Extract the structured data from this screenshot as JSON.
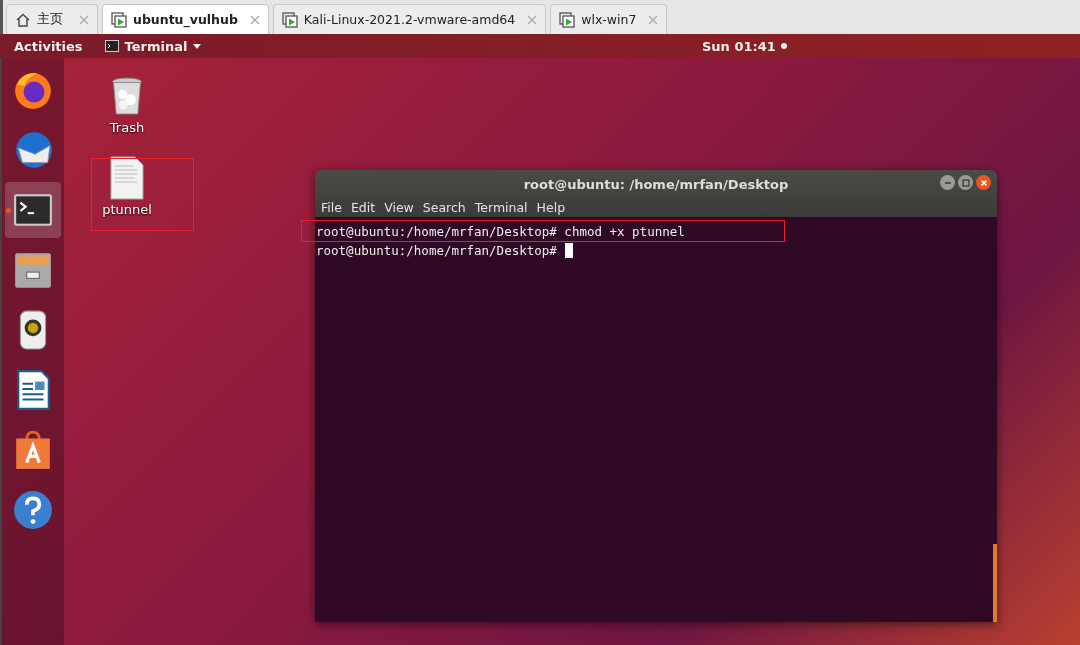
{
  "tabs": [
    {
      "label": "主页",
      "kind": "home",
      "selected": false
    },
    {
      "label": "ubuntu_vulhub",
      "kind": "vm",
      "selected": true
    },
    {
      "label": "Kali-Linux-2021.2-vmware-amd64",
      "kind": "vm",
      "selected": false
    },
    {
      "label": "wlx-win7",
      "kind": "vm",
      "selected": false
    }
  ],
  "top_bar": {
    "activities": "Activities",
    "app_menu": "Terminal",
    "clock": "Sun 01:41"
  },
  "dock": [
    {
      "kind": "firefox",
      "selected": false,
      "running": false
    },
    {
      "kind": "thunderbird",
      "selected": false,
      "running": false
    },
    {
      "kind": "terminal",
      "selected": true,
      "running": true
    },
    {
      "kind": "files",
      "selected": false,
      "running": false
    },
    {
      "kind": "rhythmbox",
      "selected": false,
      "running": false
    },
    {
      "kind": "writer",
      "selected": false,
      "running": false
    },
    {
      "kind": "software",
      "selected": false,
      "running": false
    },
    {
      "kind": "help",
      "selected": false,
      "running": false
    }
  ],
  "desktop_icons": [
    {
      "label": "Trash",
      "kind": "trash"
    },
    {
      "label": "ptunnel",
      "kind": "file"
    }
  ],
  "terminal": {
    "title": "root@ubuntu: /home/mrfan/Desktop",
    "menu": [
      "File",
      "Edit",
      "View",
      "Search",
      "Terminal",
      "Help"
    ],
    "lines": [
      {
        "prompt": "root@ubuntu:/home/mrfan/Desktop#",
        "command": "chmod +x ptunnel",
        "cursor": false
      },
      {
        "prompt": "root@ubuntu:/home/mrfan/Desktop#",
        "cursor": true
      }
    ]
  }
}
